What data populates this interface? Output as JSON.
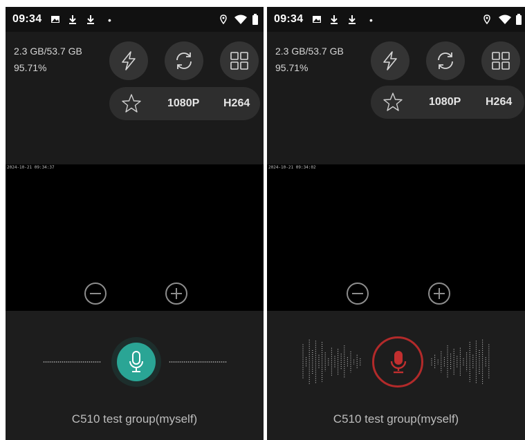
{
  "screens": [
    {
      "state": "idle",
      "status_time": "09:34",
      "storage_used": "2.3 GB/53.7 GB",
      "battery_percent": "95.71%",
      "resolution": "1080P",
      "codec": "H264",
      "timestamp": "2024-10-21 09:34:37",
      "group_name": "C510 test group(myself)"
    },
    {
      "state": "recording",
      "status_time": "09:34",
      "storage_used": "2.3 GB/53.7 GB",
      "battery_percent": "95.71%",
      "resolution": "1080P",
      "codec": "H264",
      "timestamp": "2024-10-21 09:34:02",
      "group_name": "C510 test group(myself)"
    }
  ],
  "icons": {
    "status": [
      "image-icon",
      "download-icon",
      "download-icon",
      "location-icon",
      "wifi-icon",
      "battery-icon"
    ],
    "controls": [
      "flash-icon",
      "switch-camera-icon",
      "grid-menu-icon",
      "star-icon",
      "zoom-out-icon",
      "zoom-in-icon",
      "microphone-icon"
    ]
  },
  "colors": {
    "mic_idle": "#2aa595",
    "mic_recording": "#b22a2a",
    "background": "#1c1c1c",
    "video": "#000000"
  }
}
